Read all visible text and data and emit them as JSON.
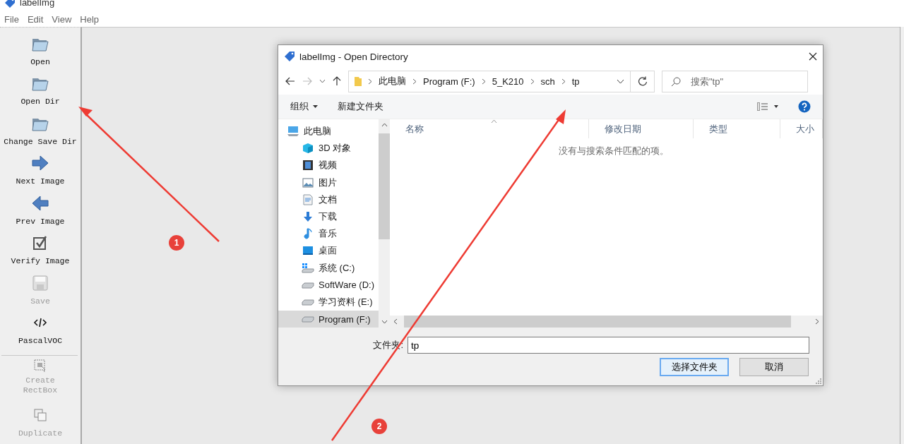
{
  "window": {
    "title": "labelImg"
  },
  "menu": [
    {
      "label": "File"
    },
    {
      "label": "Edit"
    },
    {
      "label": "View"
    },
    {
      "label": "Help"
    }
  ],
  "toolbar": [
    {
      "label": "Open",
      "kind": "folder",
      "disabled": false
    },
    {
      "label": "Open Dir",
      "kind": "folder",
      "disabled": false
    },
    {
      "label": "Change Save Dir",
      "kind": "folder",
      "disabled": false
    },
    {
      "label": "Next Image",
      "kind": "next",
      "disabled": false
    },
    {
      "label": "Prev Image",
      "kind": "prev",
      "disabled": false
    },
    {
      "label": "Verify Image",
      "kind": "verify",
      "disabled": false
    },
    {
      "label": "Save",
      "kind": "save",
      "disabled": true
    },
    {
      "label": "PascalVOC",
      "kind": "code",
      "disabled": false
    },
    {
      "label": "Create\nRectBox",
      "kind": "rectbox",
      "disabled": true,
      "separator_before": true
    },
    {
      "label": "Duplicate",
      "kind": "duplicate",
      "disabled": true
    }
  ],
  "dialog": {
    "title": "labelImg - Open Directory",
    "breadcrumb": [
      "此电脑",
      "Program (F:)",
      "5_K210",
      "sch",
      "tp"
    ],
    "search": {
      "placeholder": "搜索\"tp\""
    },
    "commands": [
      {
        "label": "组织",
        "dropdown": true
      },
      {
        "label": "新建文件夹",
        "dropdown": false
      }
    ],
    "nav": [
      {
        "label": "此电脑",
        "kind": "pc",
        "selected": false,
        "children": [
          {
            "label": "3D 对象",
            "kind": "cube",
            "selected": false
          },
          {
            "label": "视频",
            "kind": "video",
            "selected": false
          },
          {
            "label": "图片",
            "kind": "picture",
            "selected": false
          },
          {
            "label": "文档",
            "kind": "document",
            "selected": false
          },
          {
            "label": "下载",
            "kind": "download",
            "selected": false
          },
          {
            "label": "音乐",
            "kind": "music",
            "selected": false
          },
          {
            "label": "桌面",
            "kind": "desktop",
            "selected": false
          },
          {
            "label": "系统 (C:)",
            "kind": "sysdrive",
            "selected": false
          },
          {
            "label": "SoftWare (D:)",
            "kind": "drive",
            "selected": false
          },
          {
            "label": "学习资料 (E:)",
            "kind": "drive",
            "selected": false
          },
          {
            "label": "Program (F:)",
            "kind": "drive",
            "selected": true
          }
        ]
      }
    ],
    "columns": [
      "名称",
      "修改日期",
      "类型",
      "大小"
    ],
    "empty_message": "没有与搜索条件匹配的项。",
    "folder_field": {
      "label": "文件夹:",
      "value": "tp"
    },
    "buttons": [
      {
        "label": "选择文件夹",
        "default": true
      },
      {
        "label": "取消",
        "default": false
      }
    ]
  },
  "annotations": [
    {
      "number": "1"
    },
    {
      "number": "2"
    }
  ]
}
